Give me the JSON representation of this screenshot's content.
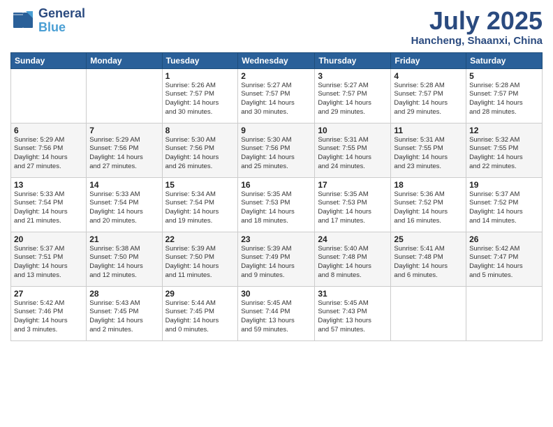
{
  "header": {
    "logo_line1": "General",
    "logo_line2": "Blue",
    "month": "July 2025",
    "location": "Hancheng, Shaanxi, China"
  },
  "days_of_week": [
    "Sunday",
    "Monday",
    "Tuesday",
    "Wednesday",
    "Thursday",
    "Friday",
    "Saturday"
  ],
  "weeks": [
    [
      {
        "num": "",
        "info": ""
      },
      {
        "num": "",
        "info": ""
      },
      {
        "num": "1",
        "info": "Sunrise: 5:26 AM\nSunset: 7:57 PM\nDaylight: 14 hours\nand 30 minutes."
      },
      {
        "num": "2",
        "info": "Sunrise: 5:27 AM\nSunset: 7:57 PM\nDaylight: 14 hours\nand 30 minutes."
      },
      {
        "num": "3",
        "info": "Sunrise: 5:27 AM\nSunset: 7:57 PM\nDaylight: 14 hours\nand 29 minutes."
      },
      {
        "num": "4",
        "info": "Sunrise: 5:28 AM\nSunset: 7:57 PM\nDaylight: 14 hours\nand 29 minutes."
      },
      {
        "num": "5",
        "info": "Sunrise: 5:28 AM\nSunset: 7:57 PM\nDaylight: 14 hours\nand 28 minutes."
      }
    ],
    [
      {
        "num": "6",
        "info": "Sunrise: 5:29 AM\nSunset: 7:56 PM\nDaylight: 14 hours\nand 27 minutes."
      },
      {
        "num": "7",
        "info": "Sunrise: 5:29 AM\nSunset: 7:56 PM\nDaylight: 14 hours\nand 27 minutes."
      },
      {
        "num": "8",
        "info": "Sunrise: 5:30 AM\nSunset: 7:56 PM\nDaylight: 14 hours\nand 26 minutes."
      },
      {
        "num": "9",
        "info": "Sunrise: 5:30 AM\nSunset: 7:56 PM\nDaylight: 14 hours\nand 25 minutes."
      },
      {
        "num": "10",
        "info": "Sunrise: 5:31 AM\nSunset: 7:55 PM\nDaylight: 14 hours\nand 24 minutes."
      },
      {
        "num": "11",
        "info": "Sunrise: 5:31 AM\nSunset: 7:55 PM\nDaylight: 14 hours\nand 23 minutes."
      },
      {
        "num": "12",
        "info": "Sunrise: 5:32 AM\nSunset: 7:55 PM\nDaylight: 14 hours\nand 22 minutes."
      }
    ],
    [
      {
        "num": "13",
        "info": "Sunrise: 5:33 AM\nSunset: 7:54 PM\nDaylight: 14 hours\nand 21 minutes."
      },
      {
        "num": "14",
        "info": "Sunrise: 5:33 AM\nSunset: 7:54 PM\nDaylight: 14 hours\nand 20 minutes."
      },
      {
        "num": "15",
        "info": "Sunrise: 5:34 AM\nSunset: 7:54 PM\nDaylight: 14 hours\nand 19 minutes."
      },
      {
        "num": "16",
        "info": "Sunrise: 5:35 AM\nSunset: 7:53 PM\nDaylight: 14 hours\nand 18 minutes."
      },
      {
        "num": "17",
        "info": "Sunrise: 5:35 AM\nSunset: 7:53 PM\nDaylight: 14 hours\nand 17 minutes."
      },
      {
        "num": "18",
        "info": "Sunrise: 5:36 AM\nSunset: 7:52 PM\nDaylight: 14 hours\nand 16 minutes."
      },
      {
        "num": "19",
        "info": "Sunrise: 5:37 AM\nSunset: 7:52 PM\nDaylight: 14 hours\nand 14 minutes."
      }
    ],
    [
      {
        "num": "20",
        "info": "Sunrise: 5:37 AM\nSunset: 7:51 PM\nDaylight: 14 hours\nand 13 minutes."
      },
      {
        "num": "21",
        "info": "Sunrise: 5:38 AM\nSunset: 7:50 PM\nDaylight: 14 hours\nand 12 minutes."
      },
      {
        "num": "22",
        "info": "Sunrise: 5:39 AM\nSunset: 7:50 PM\nDaylight: 14 hours\nand 11 minutes."
      },
      {
        "num": "23",
        "info": "Sunrise: 5:39 AM\nSunset: 7:49 PM\nDaylight: 14 hours\nand 9 minutes."
      },
      {
        "num": "24",
        "info": "Sunrise: 5:40 AM\nSunset: 7:48 PM\nDaylight: 14 hours\nand 8 minutes."
      },
      {
        "num": "25",
        "info": "Sunrise: 5:41 AM\nSunset: 7:48 PM\nDaylight: 14 hours\nand 6 minutes."
      },
      {
        "num": "26",
        "info": "Sunrise: 5:42 AM\nSunset: 7:47 PM\nDaylight: 14 hours\nand 5 minutes."
      }
    ],
    [
      {
        "num": "27",
        "info": "Sunrise: 5:42 AM\nSunset: 7:46 PM\nDaylight: 14 hours\nand 3 minutes."
      },
      {
        "num": "28",
        "info": "Sunrise: 5:43 AM\nSunset: 7:45 PM\nDaylight: 14 hours\nand 2 minutes."
      },
      {
        "num": "29",
        "info": "Sunrise: 5:44 AM\nSunset: 7:45 PM\nDaylight: 14 hours\nand 0 minutes."
      },
      {
        "num": "30",
        "info": "Sunrise: 5:45 AM\nSunset: 7:44 PM\nDaylight: 13 hours\nand 59 minutes."
      },
      {
        "num": "31",
        "info": "Sunrise: 5:45 AM\nSunset: 7:43 PM\nDaylight: 13 hours\nand 57 minutes."
      },
      {
        "num": "",
        "info": ""
      },
      {
        "num": "",
        "info": ""
      }
    ]
  ]
}
